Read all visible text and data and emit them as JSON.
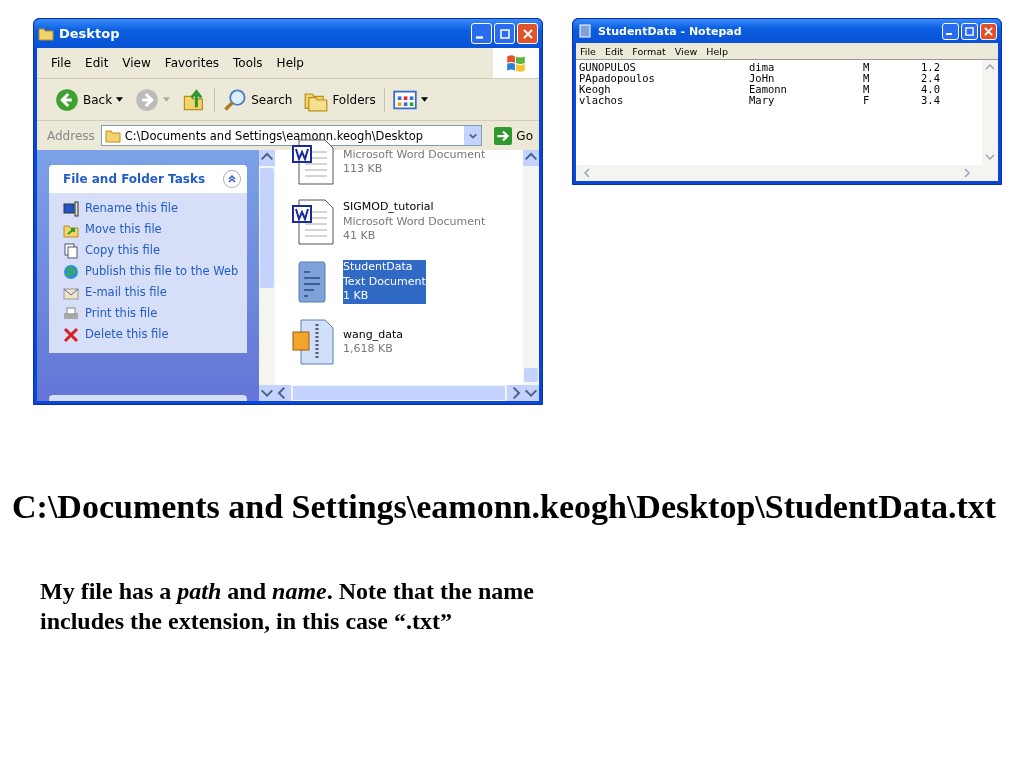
{
  "explorer": {
    "title": "Desktop",
    "menu": [
      "File",
      "Edit",
      "View",
      "Favorites",
      "Tools",
      "Help"
    ],
    "toolbar": [
      {
        "kind": "back",
        "label": "Back"
      },
      {
        "kind": "forward"
      },
      {
        "kind": "up"
      },
      {
        "kind": "search",
        "label": "Search"
      },
      {
        "kind": "folders",
        "label": "Folders"
      },
      {
        "kind": "views"
      }
    ],
    "address": {
      "label": "Address",
      "value": "C:\\Documents and Settings\\eamonn.keogh\\Desktop",
      "go": "Go"
    },
    "tasks": {
      "title": "File and Folder Tasks",
      "items": [
        {
          "kind": "rename",
          "label": "Rename this file"
        },
        {
          "kind": "move",
          "label": "Move this file"
        },
        {
          "kind": "copy",
          "label": "Copy this file"
        },
        {
          "kind": "publish",
          "label": "Publish this file to the Web"
        },
        {
          "kind": "email",
          "label": "E-mail this file"
        },
        {
          "kind": "print",
          "label": "Print this file"
        },
        {
          "kind": "delete",
          "label": "Delete this file"
        }
      ]
    },
    "files": [
      {
        "kind": "word",
        "type": "Microsoft Word Document",
        "size": "113 KB",
        "selected": false
      },
      {
        "kind": "word",
        "name": "SIGMOD_tutorial",
        "type": "Microsoft Word Document",
        "size": "41 KB",
        "selected": false
      },
      {
        "kind": "text",
        "name": "StudentData",
        "type": "Text Document",
        "size": "1 KB",
        "selected": true
      },
      {
        "kind": "zip",
        "name": "wang_data",
        "size": "1,618 KB",
        "selected": false
      }
    ]
  },
  "notepad": {
    "title": "StudentData - Notepad",
    "menu": [
      "File",
      "Edit",
      "Format",
      "View",
      "Help"
    ],
    "rows": [
      [
        "GUNOPULOS",
        "dima",
        "M",
        "1.2"
      ],
      [
        "PApadopoulos",
        "JoHn",
        "M",
        "2.4"
      ],
      [
        "Keogh",
        "Eamonn",
        "M",
        "4.0"
      ],
      [
        "vlachos",
        "Mary",
        "F",
        "3.4"
      ]
    ]
  },
  "slide": {
    "path": "C:\\Documents and Settings\\eamonn.keogh\\Desktop\\StudentData.txt",
    "note": "My file has a *path* and *name*. Note that the name includes the extension, in this case “.txt”"
  }
}
